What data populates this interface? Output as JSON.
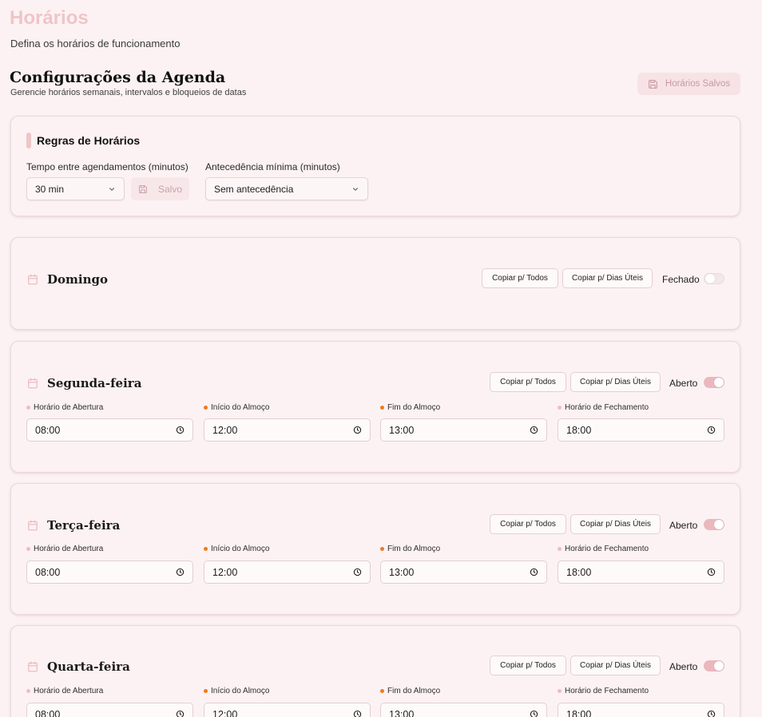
{
  "header": {
    "title": "Horários",
    "subtitle": "Defina os horários de funcionamento"
  },
  "section": {
    "title": "Configurações da Agenda",
    "subtitle": "Gerencie horários semanais, intervalos e bloqueios de datas",
    "saved_label": "Horários Salvos",
    "saved_icon": "save-icon"
  },
  "rules": {
    "title": "Regras de Horários",
    "interval_label": "Tempo entre agendamentos (minutos)",
    "interval_value": "30 min",
    "save_label": "Salvo",
    "advance_label": "Antecedência mínima (minutos)",
    "advance_value": "Sem antecedência"
  },
  "copy_all_label": "Copiar p/ Todos",
  "copy_weekdays_label": "Copiar p/ Dias Úteis",
  "time_labels": {
    "open": "Horário de Abertura",
    "lunch_start": "Início do Almoço",
    "lunch_end": "Fim do Almoço",
    "close": "Horário de Fechamento"
  },
  "days": [
    {
      "name": "Domingo",
      "status": "Fechado",
      "enabled": false
    },
    {
      "name": "Segunda-feira",
      "status": "Aberto",
      "enabled": true,
      "open": "08:00",
      "lunch_start": "12:00",
      "lunch_end": "13:00",
      "close": "18:00"
    },
    {
      "name": "Terça-feira",
      "status": "Aberto",
      "enabled": true,
      "open": "08:00",
      "lunch_start": "12:00",
      "lunch_end": "13:00",
      "close": "18:00"
    },
    {
      "name": "Quarta-feira",
      "status": "Aberto",
      "enabled": true,
      "open": "08:00",
      "lunch_start": "12:00",
      "lunch_end": "13:00",
      "close": "18:00"
    }
  ],
  "colors": {
    "accent": "#efc5c8",
    "toggle_on": "#eab8bd",
    "lunch_dot": "#f07a1c",
    "background": "#fcf2f3"
  }
}
